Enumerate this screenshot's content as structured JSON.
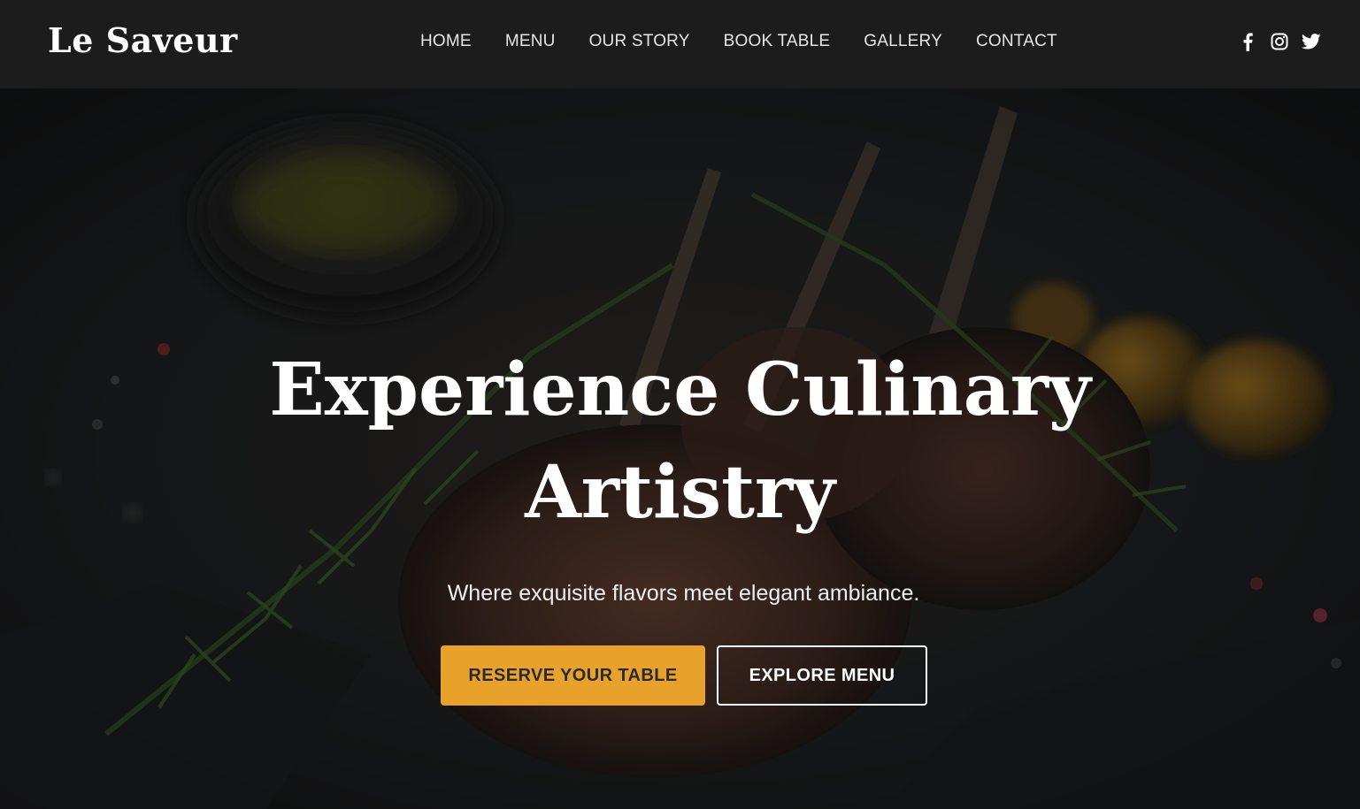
{
  "brand": {
    "name": "Le Saveur"
  },
  "nav": {
    "items": [
      {
        "label": "HOME"
      },
      {
        "label": "MENU"
      },
      {
        "label": "OUR STORY"
      },
      {
        "label": "BOOK TABLE"
      },
      {
        "label": "GALLERY"
      },
      {
        "label": "CONTACT"
      }
    ]
  },
  "socials": [
    {
      "icon": "facebook-icon"
    },
    {
      "icon": "instagram-icon"
    },
    {
      "icon": "twitter-icon"
    }
  ],
  "hero": {
    "title_line1": "Experience Culinary",
    "title_line2": "Artistry",
    "subtitle": "Where exquisite flavors meet elegant ambiance.",
    "primary_button": "RESERVE YOUR TABLE",
    "secondary_button": "EXPLORE MENU",
    "background_image": "dark food photo of grilled lamb chops with rosemary on slate"
  },
  "colors": {
    "accent": "#e8a22c",
    "navbar": "#1c1c1c",
    "text": "#ffffff"
  }
}
